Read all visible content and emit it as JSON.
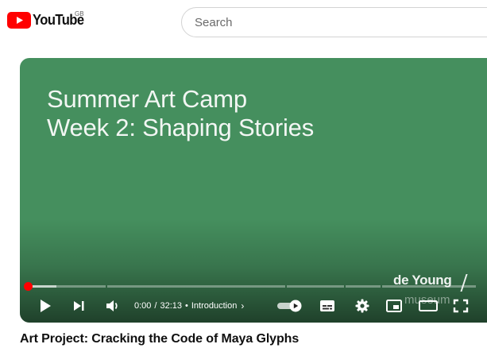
{
  "header": {
    "logo_text": "YouTube",
    "region_code": "GB",
    "search": {
      "placeholder": "Search",
      "value": ""
    }
  },
  "player": {
    "title_card": [
      "Summer Art Camp",
      "Week 2: Shaping Stories"
    ],
    "watermark": {
      "line1": "de Young",
      "line2": "museum"
    },
    "progress": {
      "played_fraction": 0.0,
      "buffered_fraction": 0.06
    },
    "time": {
      "current": "0:00",
      "separator": "/",
      "duration": "32:13"
    },
    "chapter": {
      "bullet": "•",
      "label": "Introduction",
      "chevron": "›"
    },
    "autoplay_on": true,
    "accent_color": "#ff0000",
    "background_color": "#458f5e",
    "controls": [
      "play-icon",
      "next-icon",
      "volume-icon",
      "autoplay-toggle",
      "subtitles-icon",
      "settings-gear-icon",
      "miniplayer-icon",
      "theater-mode-icon",
      "fullscreen-icon"
    ]
  },
  "video": {
    "title": "Art Project: Cracking the Code of Maya Glyphs"
  }
}
